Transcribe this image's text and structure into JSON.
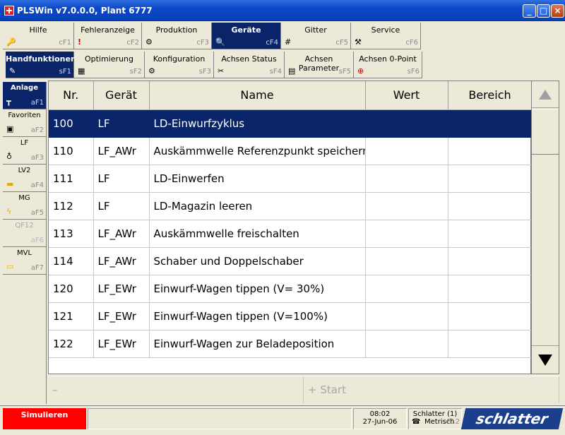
{
  "window": {
    "title": "PLSWin v7.0.0.0,  Plant 6777"
  },
  "top_tabs": [
    {
      "label": "Hilfe",
      "key": "cF1",
      "icon": "help-icon",
      "glyph": "🔑"
    },
    {
      "label": "Fehleranzeige",
      "key": "cF2",
      "icon": "alert-icon",
      "glyph": "!"
    },
    {
      "label": "Produktion",
      "key": "cF3",
      "icon": "production-icon",
      "glyph": "⚙"
    },
    {
      "label": "Geräte",
      "key": "cF4",
      "icon": "devices-icon",
      "glyph": "🔍",
      "active": true
    },
    {
      "label": "Gitter",
      "key": "cF5",
      "icon": "grid-icon",
      "glyph": "#"
    },
    {
      "label": "Service",
      "key": "cF6",
      "icon": "tools-icon",
      "glyph": "⚒"
    }
  ],
  "sub_tabs": [
    {
      "label": "Handfunktionen",
      "key": "sF1",
      "icon": "hand-function-icon",
      "glyph": "✎",
      "active": true
    },
    {
      "label": "Optimierung",
      "key": "sF2",
      "icon": "optimize-icon",
      "glyph": "▦"
    },
    {
      "label": "Konfiguration",
      "key": "sF3",
      "icon": "config-icon",
      "glyph": "⚙"
    },
    {
      "label": "Achsen Status",
      "key": "sF4",
      "icon": "axis-status-icon",
      "glyph": "✂"
    },
    {
      "label": "Achsen Parameter",
      "key": "sF5",
      "icon": "axis-param-icon",
      "glyph": "▤"
    },
    {
      "label": "Achsen 0-Point",
      "key": "sF6",
      "icon": "axis-zero-icon",
      "glyph": "⊕"
    }
  ],
  "side_tabs": [
    {
      "label": "Anlage",
      "key": "aF1",
      "icon": "plant-icon",
      "glyph": "┳",
      "active": true
    },
    {
      "label": "Favoriten",
      "key": "aF2",
      "icon": "favorites-icon",
      "glyph": "▣"
    },
    {
      "label": "LF",
      "key": "aF3",
      "icon": "lf-icon",
      "glyph": "♁"
    },
    {
      "label": "LV2",
      "key": "aF4",
      "icon": "lv2-icon",
      "glyph": "▬"
    },
    {
      "label": "MG",
      "key": "aF5",
      "icon": "mg-icon",
      "glyph": "ϟ"
    },
    {
      "label": "QF12",
      "key": "aF6",
      "icon": "qf12-icon",
      "glyph": "",
      "disabled": true
    },
    {
      "label": "MVL",
      "key": "aF7",
      "icon": "mvl-icon",
      "glyph": "▭"
    }
  ],
  "table": {
    "headers": [
      "Nr.",
      "Gerät",
      "Name",
      "Wert",
      "Bereich"
    ],
    "rows": [
      {
        "nr": "100",
        "geraet": "LF",
        "name": "LD-Einwurfzyklus",
        "wert": "",
        "bereich": "",
        "selected": true
      },
      {
        "nr": "110",
        "geraet": "LF_AWr",
        "name": "Auskämmwelle Referenzpunkt speichern",
        "wert": "",
        "bereich": ""
      },
      {
        "nr": "111",
        "geraet": "LF",
        "name": "LD-Einwerfen",
        "wert": "",
        "bereich": ""
      },
      {
        "nr": "112",
        "geraet": "LF",
        "name": "LD-Magazin leeren",
        "wert": "",
        "bereich": ""
      },
      {
        "nr": "113",
        "geraet": "LF_AWr",
        "name": "Auskämmwelle freischalten",
        "wert": "",
        "bereich": ""
      },
      {
        "nr": "114",
        "geraet": "LF_AWr",
        "name": "Schaber und Doppelschaber",
        "wert": "",
        "bereich": ""
      },
      {
        "nr": "120",
        "geraet": "LF_EWr",
        "name": "Einwurf-Wagen tippen (V= 30%)",
        "wert": "",
        "bereich": ""
      },
      {
        "nr": "121",
        "geraet": "LF_EWr",
        "name": "Einwurf-Wagen tippen (V=100%)",
        "wert": "",
        "bereich": ""
      },
      {
        "nr": "122",
        "geraet": "LF_EWr",
        "name": "Einwurf-Wagen zur Beladeposition",
        "wert": "",
        "bereich": ""
      }
    ]
  },
  "actions": {
    "minus": "–",
    "start": "+ Start"
  },
  "status": {
    "simulate": "Simulieren",
    "time": "08:02",
    "date": "27-Jun-06",
    "user": "Schlatter (1)",
    "units": "Metrisch",
    "units_key": "F12",
    "logo": "schlatter"
  }
}
